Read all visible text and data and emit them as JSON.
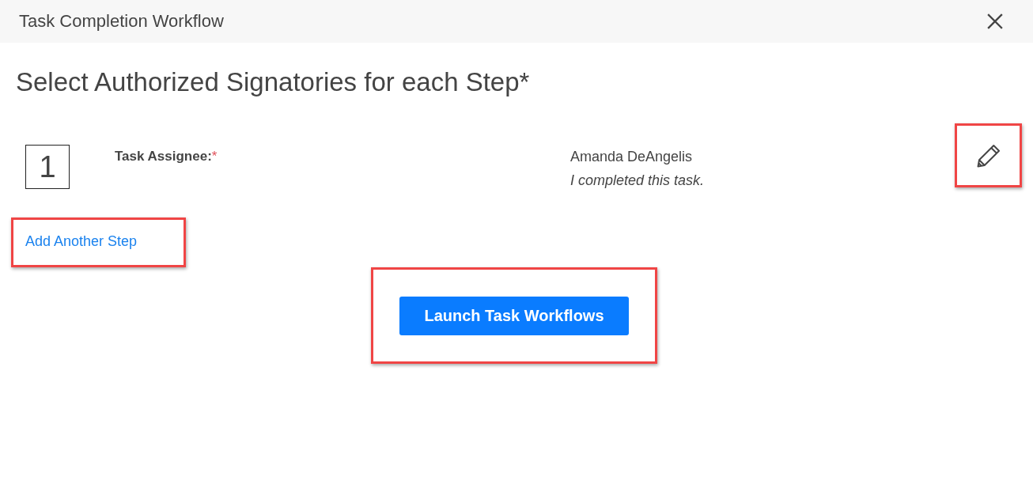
{
  "window": {
    "title": "Task Completion Workflow"
  },
  "heading": "Select Authorized Signatories for each Step*",
  "steps": [
    {
      "number": "1",
      "label": "Task Assignee:",
      "required_mark": "*",
      "assignee": "Amanda DeAngelis",
      "status": "I completed this task.",
      "edit_highlighted": true
    }
  ],
  "add_step": {
    "label": "Add Another Step",
    "highlighted": true
  },
  "launch_button": {
    "label": "Launch Task Workflows",
    "highlighted": true
  }
}
